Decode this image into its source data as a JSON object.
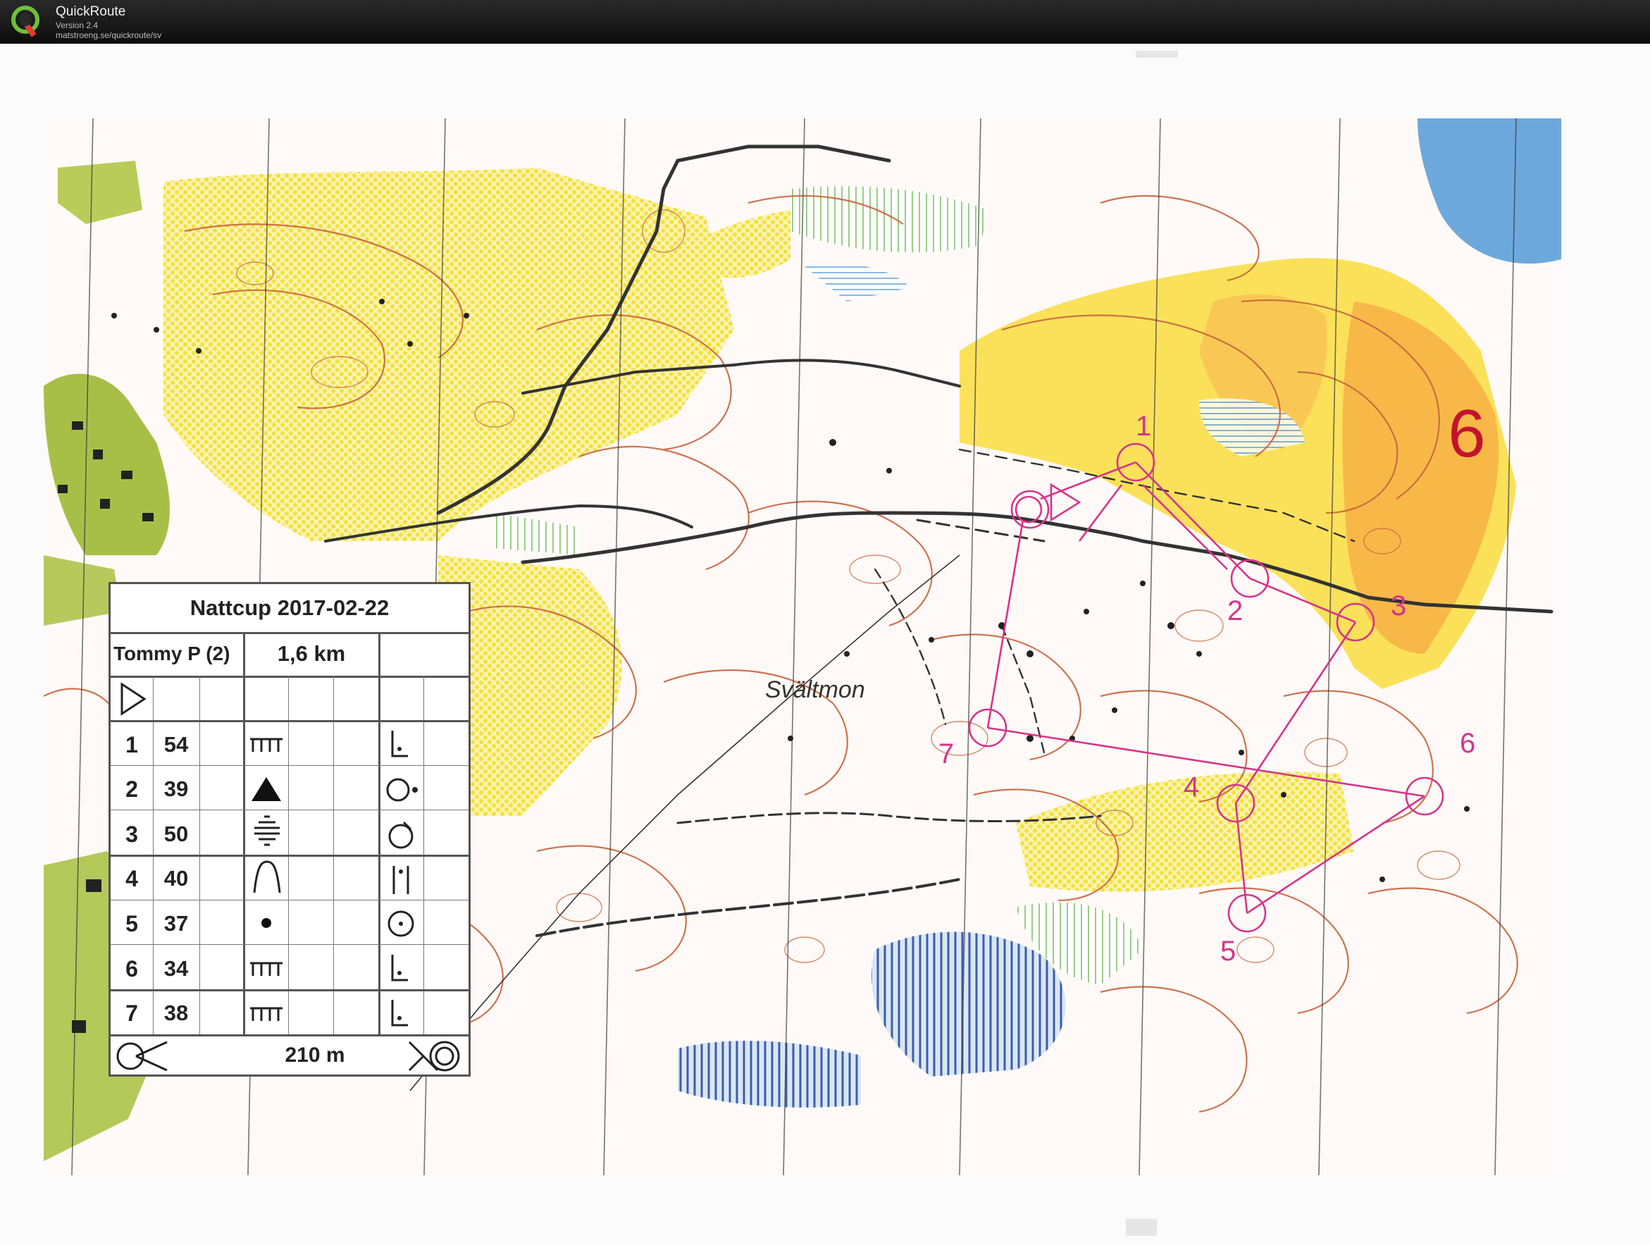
{
  "app": {
    "title": "QuickRoute",
    "version": "Version 2.4",
    "url": "matstroeng.se/quickroute/sv"
  },
  "map": {
    "place_name": "Svältmon",
    "page_number": "6",
    "control_labels": [
      "1",
      "2",
      "3",
      "4",
      "5",
      "6",
      "7"
    ],
    "colors": {
      "course": "#d6338a",
      "contour": "#c8643c",
      "open_land": "#f6e23a",
      "rough_open": "#f5a623",
      "forest_green": "#9ab83a",
      "water": "#6aa9e0",
      "road": "#333333"
    }
  },
  "control_card": {
    "title": "Nattcup 2017-02-22",
    "runner": "Tommy P (2)",
    "length": "1,6 km",
    "start_symbol": "start-triangle-icon",
    "controls": [
      {
        "number": "1",
        "code": "54",
        "feature": "fence-icon",
        "detail": "corner-icon"
      },
      {
        "number": "2",
        "code": "39",
        "feature": "knoll-solid-icon",
        "detail": "east-side-icon"
      },
      {
        "number": "3",
        "code": "50",
        "feature": "marsh-icon",
        "detail": "north-east-side-icon"
      },
      {
        "number": "4",
        "code": "40",
        "feature": "hill-icon",
        "detail": "between-icon"
      },
      {
        "number": "5",
        "code": "37",
        "feature": "small-knoll-icon",
        "detail": "center-icon"
      },
      {
        "number": "6",
        "code": "34",
        "feature": "fence-icon",
        "detail": "corner-icon"
      },
      {
        "number": "7",
        "code": "38",
        "feature": "fence-icon",
        "detail": "corner-icon"
      }
    ],
    "finish_distance": "210 m"
  }
}
